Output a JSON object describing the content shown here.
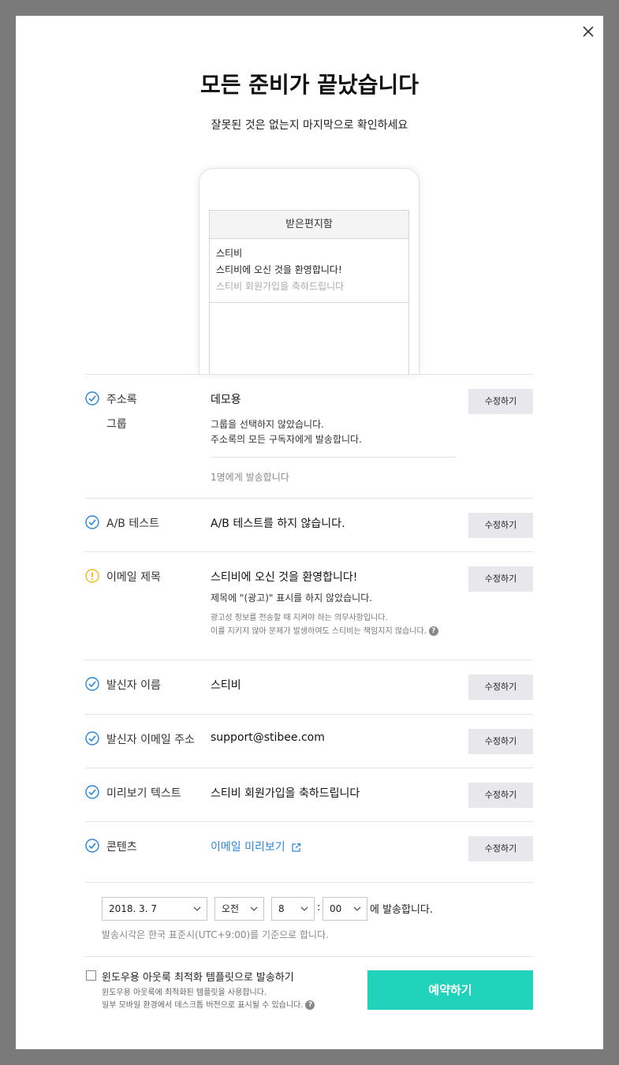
{
  "modal": {
    "title": "모든 준비가 끝났습니다",
    "subtitle": "잘못된 것은 없는지 마지막으로 확인하세요"
  },
  "preview": {
    "inbox_title": "받은편지함",
    "sender": "스티비",
    "subject": "스티비에 오신 것을 환영합니다!",
    "preview_text": "스티비 회원가입을 축하드립니다"
  },
  "edit_label": "수정하기",
  "rows": {
    "address_book": {
      "label": "주소록",
      "sublabel": "그룹",
      "value": "데모용",
      "group_line1": "그룹을 선택하지 않았습니다.",
      "group_line2": "주소록의 모든 구독자에게 발송합니다.",
      "recipient_count": "1명에게 발송합니다",
      "status": "ok"
    },
    "ab_test": {
      "label": "A/B 테스트",
      "value": "A/B 테스트를 하지 않습니다.",
      "status": "ok"
    },
    "subject": {
      "label": "이메일 제목",
      "value": "스티비에 오신 것을 환영합니다!",
      "ad_notice": "제목에 \"(광고)\" 표시를 하지 않았습니다.",
      "legal_line1": "광고성 정보를 전송할 때 지켜야 하는 의무사항입니다.",
      "legal_line2": "이를 지키지 않아 문제가 발생하여도 스티비는 책임지지 않습니다.",
      "status": "warning"
    },
    "sender_name": {
      "label": "발신자 이름",
      "value": "스티비",
      "status": "ok"
    },
    "sender_email": {
      "label": "발신자 이메일 주소",
      "value": "support@stibee.com",
      "status": "ok"
    },
    "preview_text": {
      "label": "미리보기 텍스트",
      "value": "스티비 회원가입을 축하드립니다",
      "status": "ok"
    },
    "contents": {
      "label": "콘텐츠",
      "link": "이메일 미리보기",
      "status": "ok"
    }
  },
  "schedule": {
    "date": "2018. 3. 7",
    "ampm": "오전",
    "hour": "8",
    "minute": "00",
    "colon": ":",
    "suffix": "에 발송합니다.",
    "timezone_note": "발송시각은 한국 표준시(UTC+9:00)를 기준으로 합니다."
  },
  "outlook": {
    "label": "윈도우용 아웃룩 최적화 템플릿으로 발송하기",
    "checked": false,
    "note1": "윈도우용 아웃룩에 최적화된 템플릿을 사용합니다.",
    "note2": "일부 모바일 환경에서 데스크톱 버전으로 표시될 수 있습니다."
  },
  "reserve_button": "예약하기",
  "colors": {
    "accent": "#22d3bb",
    "check": "#2a86d6",
    "warning": "#f2b81e",
    "link": "#2a86d6",
    "overlay": "#7a7a7a"
  }
}
